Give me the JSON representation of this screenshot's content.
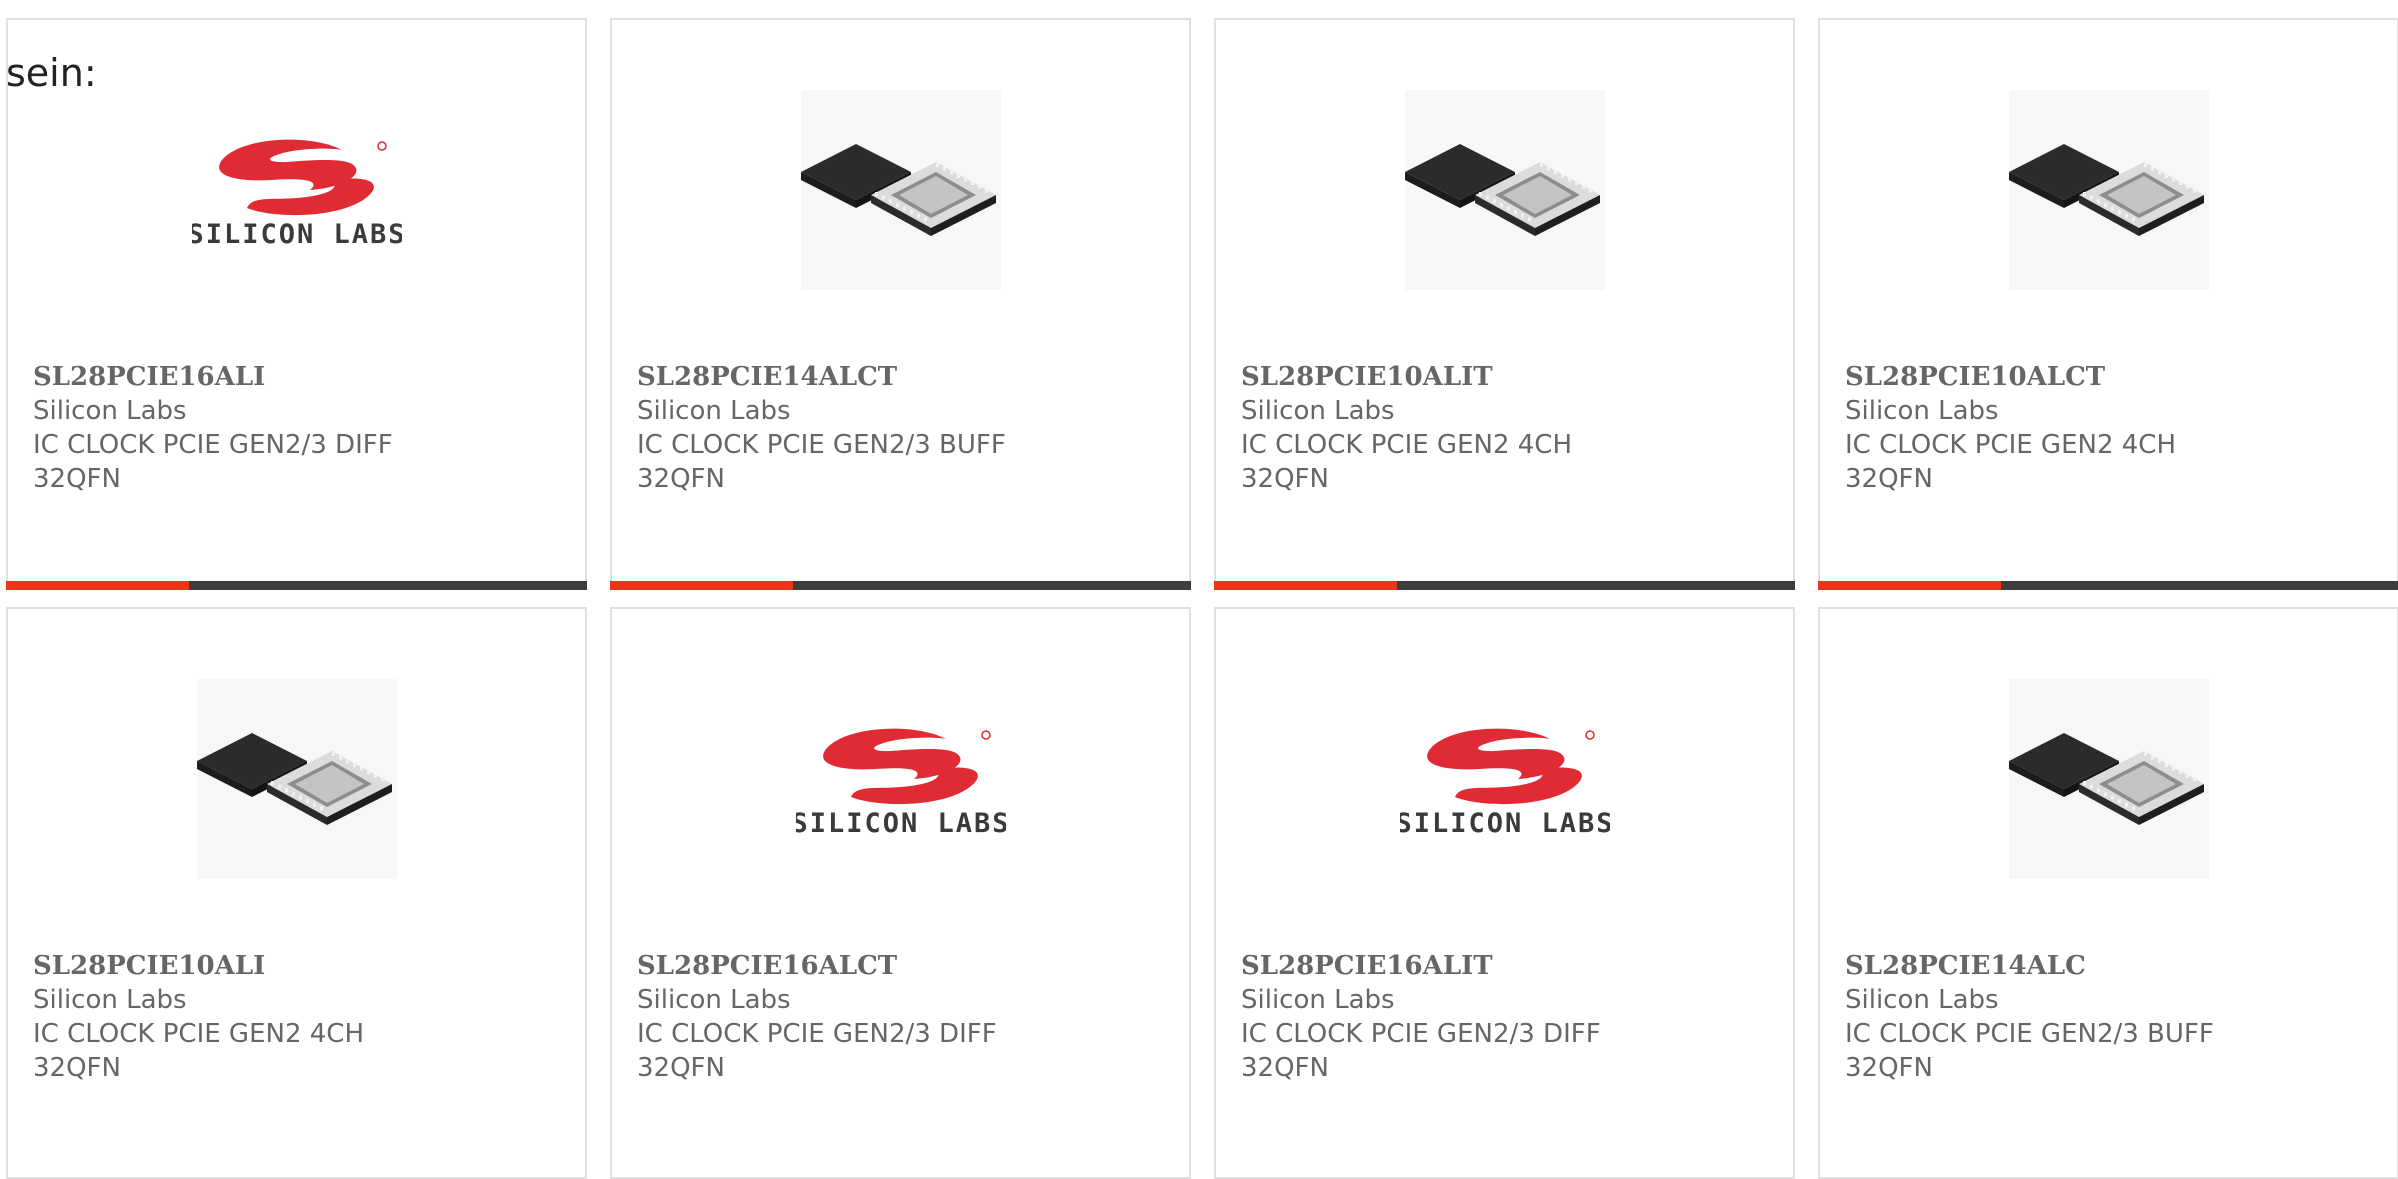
{
  "intro_text": "sein:",
  "colors": {
    "accent": "#e8381a",
    "bar": "#3d3d3d",
    "logo_red": "#e02b35",
    "text_grey": "#666666"
  },
  "accent_fraction": 0.315,
  "products": [
    {
      "part_number": "SL28PCIE16ALI",
      "manufacturer": "Silicon Labs",
      "description": "IC CLOCK PCIE GEN2/3 DIFF 32QFN",
      "image": "silicon-labs-logo",
      "logo_text": "SILICON LABS",
      "show_bar": true
    },
    {
      "part_number": "SL28PCIE14ALCT",
      "manufacturer": "Silicon Labs",
      "description": "IC CLOCK PCIE GEN2/3 BUFF 32QFN",
      "image": "qfn-chip",
      "show_bar": true
    },
    {
      "part_number": "SL28PCIE10ALIT",
      "manufacturer": "Silicon Labs",
      "description": "IC CLOCK PCIE GEN2 4CH 32QFN",
      "image": "qfn-chip",
      "show_bar": true
    },
    {
      "part_number": "SL28PCIE10ALCT",
      "manufacturer": "Silicon Labs",
      "description": "IC CLOCK PCIE GEN2 4CH 32QFN",
      "image": "qfn-chip",
      "show_bar": true
    },
    {
      "part_number": "SL28PCIE10ALI",
      "manufacturer": "Silicon Labs",
      "description": "IC CLOCK PCIE GEN2 4CH 32QFN",
      "image": "qfn-chip",
      "show_bar": false
    },
    {
      "part_number": "SL28PCIE16ALCT",
      "manufacturer": "Silicon Labs",
      "description": "IC CLOCK PCIE GEN2/3 DIFF 32QFN",
      "image": "silicon-labs-logo",
      "logo_text": "SILICON LABS",
      "show_bar": false
    },
    {
      "part_number": "SL28PCIE16ALIT",
      "manufacturer": "Silicon Labs",
      "description": "IC CLOCK PCIE GEN2/3 DIFF 32QFN",
      "image": "silicon-labs-logo",
      "logo_text": "SILICON LABS",
      "show_bar": false
    },
    {
      "part_number": "SL28PCIE14ALC",
      "manufacturer": "Silicon Labs",
      "description": "IC CLOCK PCIE GEN2/3 BUFF 32QFN",
      "image": "qfn-chip",
      "show_bar": false
    }
  ]
}
